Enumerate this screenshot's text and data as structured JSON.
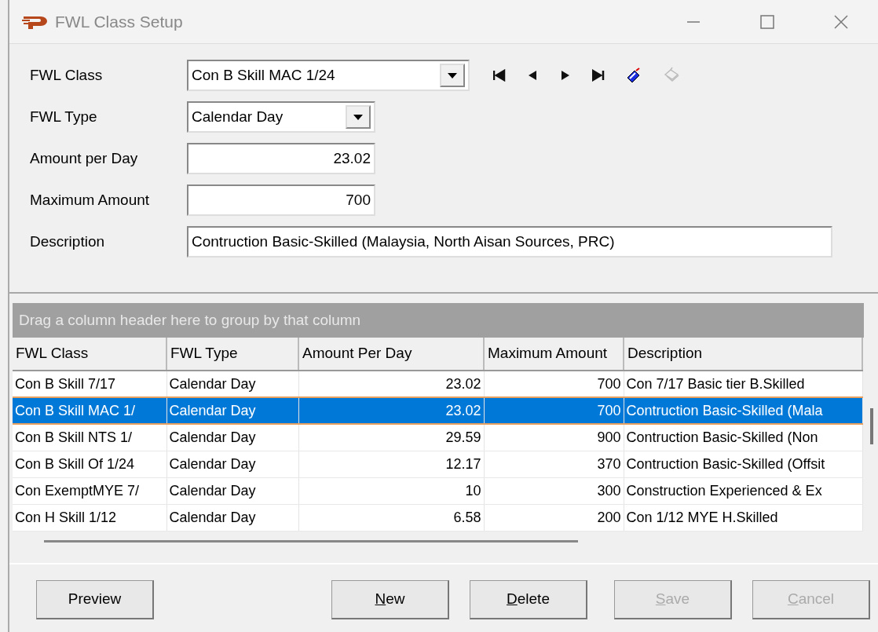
{
  "window": {
    "title": "FWL Class Setup"
  },
  "form": {
    "fields": [
      {
        "kind": "combo",
        "label": "FWL Class",
        "value": "Con B Skill MAC 1/24"
      },
      {
        "kind": "combo",
        "label": "FWL Type",
        "value": "Calendar Day"
      },
      {
        "kind": "number",
        "label": "Amount per Day",
        "value": "23.02"
      },
      {
        "kind": "number",
        "label": "Maximum Amount",
        "value": "700"
      },
      {
        "kind": "text",
        "label": "Description",
        "value": "Contruction Basic-Skilled (Malaysia, North Aisan Sources, PRC)"
      }
    ],
    "nav": [
      {
        "kind": "first"
      },
      {
        "kind": "prev"
      },
      {
        "kind": "next"
      },
      {
        "kind": "last"
      },
      {
        "kind": "tag"
      },
      {
        "kind": "goto",
        "disabled": true
      }
    ]
  },
  "grid": {
    "group_hint": "Drag a column header here to group by that column",
    "columns": [
      {
        "label": "FWL Class"
      },
      {
        "label": "FWL Type"
      },
      {
        "label": "Amount Per Day"
      },
      {
        "label": "Maximum Amount"
      },
      {
        "label": "Description"
      }
    ],
    "rows": [
      {
        "selected": false,
        "cells": [
          "Con B Skill 7/17",
          "Calendar Day",
          "23.02",
          "700",
          "Con 7/17 Basic tier B.Skilled"
        ]
      },
      {
        "selected": true,
        "cells": [
          "Con B Skill MAC 1/",
          "Calendar Day",
          "23.02",
          "700",
          "Contruction Basic-Skilled (Mala"
        ]
      },
      {
        "selected": false,
        "cells": [
          "Con B Skill NTS 1/",
          "Calendar Day",
          "29.59",
          "900",
          "Contruction Basic-Skilled (Non"
        ]
      },
      {
        "selected": false,
        "cells": [
          "Con B Skill Of 1/24",
          "Calendar Day",
          "12.17",
          "370",
          "Contruction Basic-Skilled (Offsit"
        ]
      },
      {
        "selected": false,
        "cells": [
          "Con ExemptMYE 7/",
          "Calendar Day",
          "10",
          "300",
          "Construction Experienced & Ex"
        ]
      },
      {
        "selected": false,
        "cells": [
          "Con H Skill 1/12",
          "Calendar Day",
          "6.58",
          "200",
          "Con 1/12 MYE H.Skilled"
        ]
      }
    ]
  },
  "buttons": [
    {
      "label": "Preview",
      "underline_first": false,
      "disabled": false
    },
    {
      "label": "New",
      "underline_first": true,
      "disabled": false
    },
    {
      "label": "Delete",
      "underline_first": true,
      "disabled": false
    },
    {
      "label": "Save",
      "underline_first": true,
      "disabled": true
    },
    {
      "label": "Cancel",
      "underline_first": true,
      "disabled": true
    }
  ]
}
